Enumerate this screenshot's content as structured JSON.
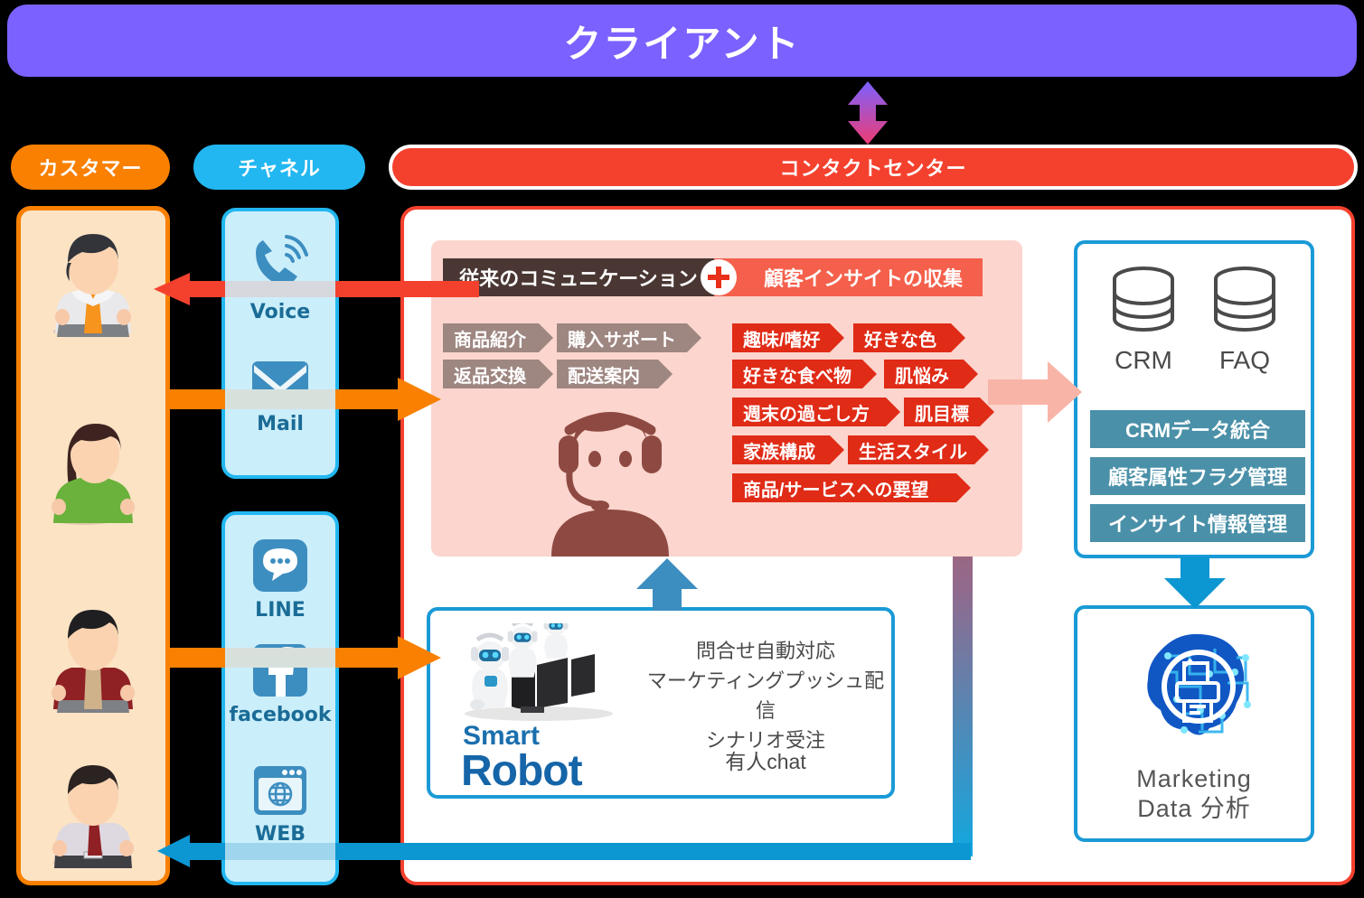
{
  "header": {
    "client_label": "クライアント",
    "client_color": "#7b61ff"
  },
  "pills": {
    "customer": "カスタマー",
    "channel": "チャネル",
    "contact_center": "コンタクトセンター",
    "customer_color": "#f98000",
    "channel_color": "#22b7f0",
    "center_color": "#f4412e"
  },
  "customers": [
    {
      "name": "customer-male-white-shirt"
    },
    {
      "name": "customer-female-green"
    },
    {
      "name": "customer-male-red-jacket"
    },
    {
      "name": "customer-male-tie"
    }
  ],
  "channels": {
    "group_top": [
      {
        "icon": "phone-icon",
        "label": "Voice"
      },
      {
        "icon": "mail-icon",
        "label": "Mail"
      }
    ],
    "group_bottom": [
      {
        "icon": "line-chat-icon",
        "label": "LINE"
      },
      {
        "icon": "facebook-icon",
        "label": "facebook"
      },
      {
        "icon": "web-browser-icon",
        "label": "WEB"
      }
    ]
  },
  "insight_panel": {
    "header_left": "従来のコミュニケーション",
    "header_right": "顧客インサイトの収集",
    "plus_icon": "plus-icon",
    "header_left_color": "#4a3733",
    "header_right_color": "#f4604b",
    "panel_color": "#fbd5ce",
    "legacy_tags": [
      "商品紹介",
      "購入サポート",
      "返品交換",
      "配送案内"
    ],
    "insight_tags": [
      "趣味/嗜好",
      "好きな色",
      "好きな食べ物",
      "肌悩み",
      "週末の過ごし方",
      "肌目標",
      "家族構成",
      "生活スタイル",
      "商品/サービスへの要望"
    ],
    "agent_icon": "headset-operator-icon"
  },
  "smart_robot": {
    "brand_top": "Smart",
    "brand_bottom": "Robot",
    "brand_color": "#1565a8",
    "features": "問合せ自動対応\nマーケティングプッシュ配信\nシナリオ受注",
    "feature_lines": [
      "問合せ自動対応",
      "マーケティングプッシュ配信",
      "シナリオ受注"
    ],
    "chat_label": "有人chat",
    "robots_icon": "robot-operators-icon"
  },
  "crm_panel": {
    "db_left_label": "CRM",
    "db_right_label": "FAQ",
    "db_icon": "database-cylinder-icon",
    "rows": [
      "CRMデータ統合",
      "顧客属性フラグ管理",
      "インサイト情報管理"
    ],
    "row_color": "#4a90a8"
  },
  "marketing_panel": {
    "label_line1": "Marketing",
    "label_line2": "Data  分析",
    "icon": "ai-brain-circuit-icon"
  },
  "connectors": {
    "client_link": "bidirectional-gradient-arrow",
    "voice_out": "red-arrow-left",
    "mail_in": "orange-arrow-right",
    "line_in": "orange-arrow-right",
    "web_out": "blue-arrow-left",
    "insight_to_crm": "pink-arrow-right",
    "robot_to_agent": "blue-arrow-up",
    "crm_to_marketing": "blue-arrow-down",
    "insight_down_line": "red-to-blue-gradient-line"
  }
}
